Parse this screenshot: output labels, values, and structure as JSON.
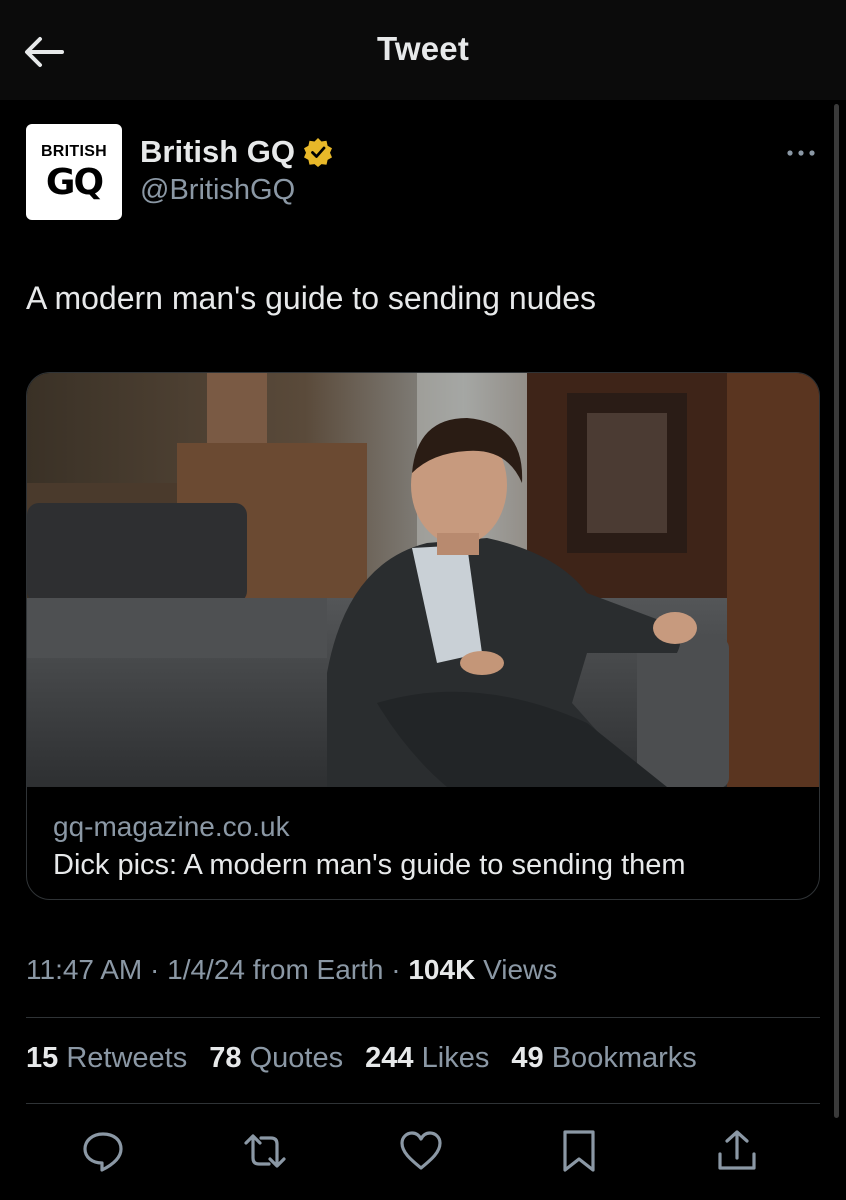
{
  "header": {
    "title": "Tweet",
    "back_icon": "arrow-left-icon"
  },
  "author": {
    "avatar_line1": "BRITISH",
    "avatar_line2": "GQ",
    "display_name": "British GQ",
    "handle": "@BritishGQ",
    "verified_icon": "verified-badge-icon",
    "verified_color": "#e8b829"
  },
  "tweet": {
    "text": "A modern man's guide to sending nudes"
  },
  "card": {
    "domain": "gq-magazine.co.uk",
    "title": "Dick pics: A modern man's guide to sending them"
  },
  "meta": {
    "time": "11:47 AM",
    "date": "1/4/24",
    "source": "from Earth",
    "views_count": "104K",
    "views_label": "Views"
  },
  "stats": {
    "retweets_count": "15",
    "retweets_label": "Retweets",
    "quotes_count": "78",
    "quotes_label": "Quotes",
    "likes_count": "244",
    "likes_label": "Likes",
    "bookmarks_count": "49",
    "bookmarks_label": "Bookmarks"
  },
  "actions": [
    "reply-icon",
    "retweet-icon",
    "like-icon",
    "bookmark-icon",
    "share-icon"
  ],
  "colors": {
    "background": "#000000",
    "text": "#e7e9ea",
    "secondary": "#8b98a5",
    "border": "#2f3336"
  }
}
